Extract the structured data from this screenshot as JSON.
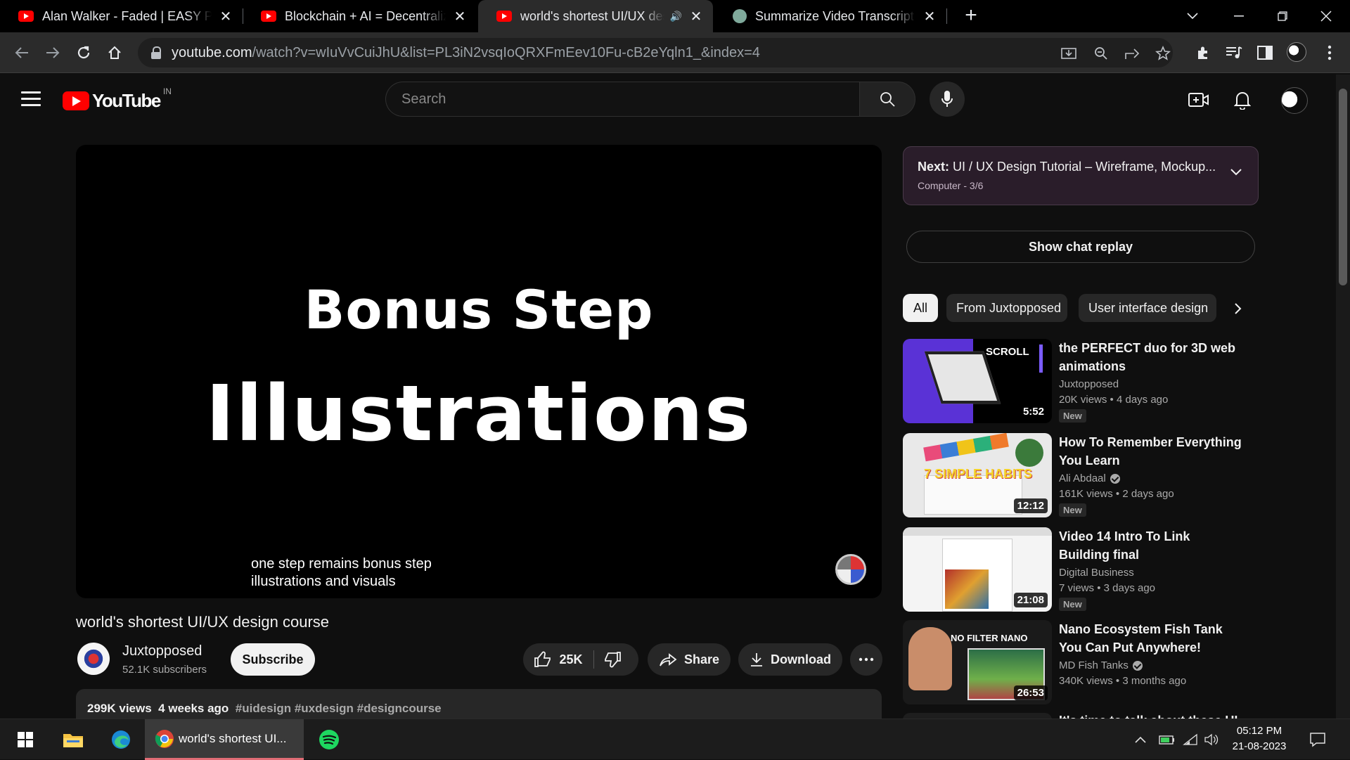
{
  "browser": {
    "tabs": [
      {
        "title": "Alan Walker - Faded | EASY Piano",
        "icon": "youtube-icon",
        "active": false
      },
      {
        "title": "Blockchain + AI = Decentralized",
        "icon": "youtube-icon",
        "active": false
      },
      {
        "title": "world's shortest UI/UX design",
        "icon": "youtube-icon",
        "active": true,
        "audio": true
      },
      {
        "title": "Summarize Video Transcript",
        "icon": "chatgpt-icon",
        "active": false
      }
    ],
    "url_host": "youtube.com",
    "url_path": "/watch?v=wIuVvCuiJhU&list=PL3iN2vsqIoQRXFmEev10Fu-cB2eYqln1_&index=4"
  },
  "header": {
    "logo_text": "YouTube",
    "country_code": "IN",
    "search_placeholder": "Search"
  },
  "player": {
    "slide_heading": "Bonus Step",
    "slide_main": "Illustrations",
    "caption_line1": "one step remains bonus step",
    "caption_line2": "illustrations and visuals"
  },
  "video": {
    "title": "world's shortest UI/UX design course",
    "channel": "Juxtopposed",
    "subscribers": "52.1K subscribers",
    "subscribe_label": "Subscribe",
    "likes": "25K",
    "share_label": "Share",
    "download_label": "Download",
    "views": "299K views",
    "age": "4 weeks ago",
    "tags": "#uidesign #uxdesign #designcourse"
  },
  "sidebar": {
    "next_prefix": "Next:",
    "next_title": "UI / UX Design Tutorial – Wireframe, Mockup...",
    "next_sub": "Computer - 3/6",
    "chat_replay": "Show chat replay",
    "chips": [
      "All",
      "From Juxtopposed",
      "User interface design"
    ],
    "recommendations": [
      {
        "title": "the PERFECT duo for 3D web animations",
        "channel": "Juxtopposed",
        "verified": false,
        "views": "20K views",
        "age": "4 days ago",
        "badge": "New",
        "duration": "5:52",
        "thumb_text": "SCROLL"
      },
      {
        "title": "How To Remember Everything You Learn",
        "channel": "Ali Abdaal",
        "verified": true,
        "views": "161K views",
        "age": "2 days ago",
        "badge": "New",
        "duration": "12:12",
        "thumb_text": "7 SIMPLE HABITS"
      },
      {
        "title": "Video 14 Intro To Link Building final",
        "channel": "Digital Business",
        "verified": false,
        "views": "7 views",
        "age": "3 days ago",
        "badge": "New",
        "duration": "21:08",
        "thumb_text": ""
      },
      {
        "title": "Nano Ecosystem Fish Tank You Can Put Anywhere!",
        "channel": "MD Fish Tanks",
        "verified": true,
        "views": "340K views",
        "age": "3 months ago",
        "badge": "",
        "duration": "26:53",
        "thumb_text": "NO FILTER NANO"
      },
      {
        "title": "It's time to talk about these UI",
        "channel": "",
        "verified": false,
        "views": "",
        "age": "",
        "badge": "",
        "duration": "",
        "thumb_text": ""
      }
    ]
  },
  "taskbar": {
    "active_app_label": "world's shortest UI...",
    "time": "05:12 PM",
    "date": "21-08-2023"
  },
  "colors": {
    "yt_red": "#ff0000",
    "background": "#0f0f0f",
    "next_card": "#2a1d2a",
    "taskbar_accent": "#e06c75"
  }
}
